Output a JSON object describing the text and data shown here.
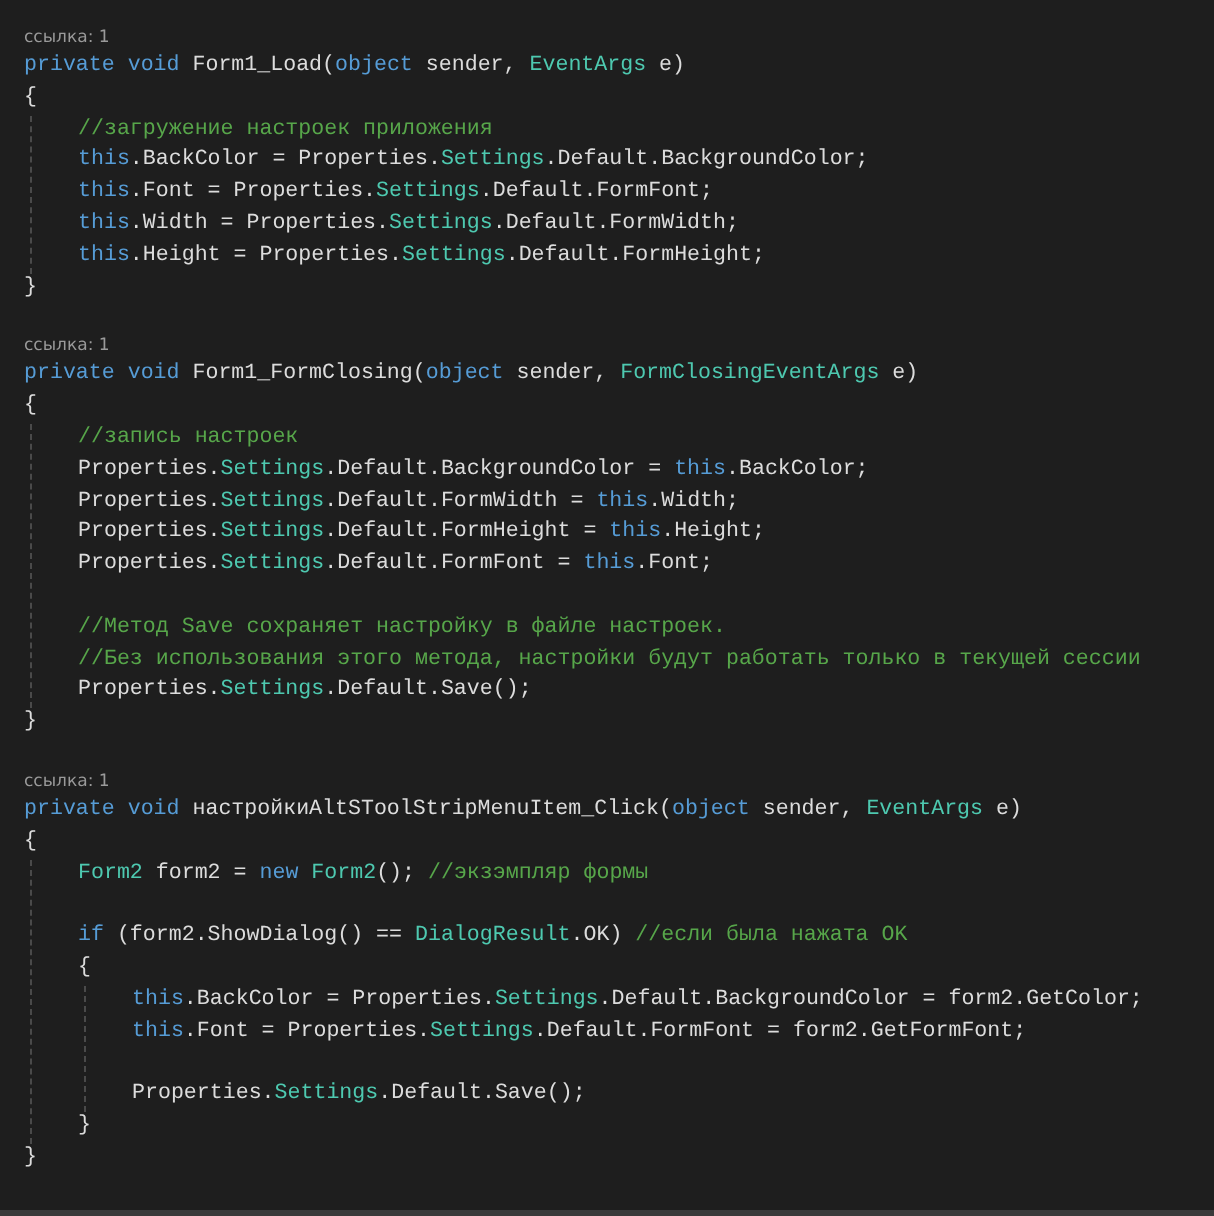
{
  "methods": [
    {
      "reference": "ссылка: 1",
      "signature": [
        {
          "kind": "keyword",
          "text": "private void"
        },
        {
          "kind": "plain",
          "text": " Form1_Load("
        },
        {
          "kind": "keyword",
          "text": "object"
        },
        {
          "kind": "plain",
          "text": " sender, "
        },
        {
          "kind": "type",
          "text": "EventArgs"
        },
        {
          "kind": "plain",
          "text": " e)"
        }
      ],
      "body": {
        "kind": "block",
        "open": "{",
        "close": "}",
        "children": [
          {
            "kind": "line",
            "tokens": [
              {
                "kind": "comment",
                "text": "//загружение настроек приложения"
              }
            ]
          },
          {
            "kind": "line",
            "tokens": [
              {
                "kind": "keyword",
                "text": "this"
              },
              {
                "kind": "plain",
                "text": ".BackColor = Properties."
              },
              {
                "kind": "type",
                "text": "Settings"
              },
              {
                "kind": "plain",
                "text": ".Default.BackgroundColor;"
              }
            ]
          },
          {
            "kind": "line",
            "tokens": [
              {
                "kind": "keyword",
                "text": "this"
              },
              {
                "kind": "plain",
                "text": ".Font = Properties."
              },
              {
                "kind": "type",
                "text": "Settings"
              },
              {
                "kind": "plain",
                "text": ".Default.FormFont;"
              }
            ]
          },
          {
            "kind": "line",
            "tokens": [
              {
                "kind": "keyword",
                "text": "this"
              },
              {
                "kind": "plain",
                "text": ".Width = Properties."
              },
              {
                "kind": "type",
                "text": "Settings"
              },
              {
                "kind": "plain",
                "text": ".Default.FormWidth;"
              }
            ]
          },
          {
            "kind": "line",
            "tokens": [
              {
                "kind": "keyword",
                "text": "this"
              },
              {
                "kind": "plain",
                "text": ".Height = Properties."
              },
              {
                "kind": "type",
                "text": "Settings"
              },
              {
                "kind": "plain",
                "text": ".Default.FormHeight;"
              }
            ]
          }
        ]
      }
    },
    {
      "reference": "ссылка: 1",
      "signature": [
        {
          "kind": "keyword",
          "text": "private void"
        },
        {
          "kind": "plain",
          "text": " Form1_FormClosing("
        },
        {
          "kind": "keyword",
          "text": "object"
        },
        {
          "kind": "plain",
          "text": " sender, "
        },
        {
          "kind": "type",
          "text": "FormClosingEventArgs"
        },
        {
          "kind": "plain",
          "text": " e)"
        }
      ],
      "body": {
        "kind": "block",
        "open": "{",
        "close": "}",
        "children": [
          {
            "kind": "line",
            "tokens": [
              {
                "kind": "comment",
                "text": "//запись настроек"
              }
            ]
          },
          {
            "kind": "line",
            "tokens": [
              {
                "kind": "plain",
                "text": "Properties."
              },
              {
                "kind": "type",
                "text": "Settings"
              },
              {
                "kind": "plain",
                "text": ".Default.BackgroundColor = "
              },
              {
                "kind": "keyword",
                "text": "this"
              },
              {
                "kind": "plain",
                "text": ".BackColor;"
              }
            ]
          },
          {
            "kind": "line",
            "tokens": [
              {
                "kind": "plain",
                "text": "Properties."
              },
              {
                "kind": "type",
                "text": "Settings"
              },
              {
                "kind": "plain",
                "text": ".Default.FormWidth = "
              },
              {
                "kind": "keyword",
                "text": "this"
              },
              {
                "kind": "plain",
                "text": ".Width;"
              }
            ]
          },
          {
            "kind": "line",
            "tokens": [
              {
                "kind": "plain",
                "text": "Properties."
              },
              {
                "kind": "type",
                "text": "Settings"
              },
              {
                "kind": "plain",
                "text": ".Default.FormHeight = "
              },
              {
                "kind": "keyword",
                "text": "this"
              },
              {
                "kind": "plain",
                "text": ".Height;"
              }
            ]
          },
          {
            "kind": "line",
            "tokens": [
              {
                "kind": "plain",
                "text": "Properties."
              },
              {
                "kind": "type",
                "text": "Settings"
              },
              {
                "kind": "plain",
                "text": ".Default.FormFont = "
              },
              {
                "kind": "keyword",
                "text": "this"
              },
              {
                "kind": "plain",
                "text": ".Font;"
              }
            ]
          },
          {
            "kind": "blank"
          },
          {
            "kind": "line",
            "tokens": [
              {
                "kind": "comment",
                "text": "//Метод Save сохраняет настройку в файле настроек."
              }
            ]
          },
          {
            "kind": "line",
            "tokens": [
              {
                "kind": "comment",
                "text": "//Без использования этого метода, настройки будут работать только в текущей сессии"
              }
            ]
          },
          {
            "kind": "line",
            "tokens": [
              {
                "kind": "plain",
                "text": "Properties."
              },
              {
                "kind": "type",
                "text": "Settings"
              },
              {
                "kind": "plain",
                "text": ".Default.Save();"
              }
            ]
          }
        ]
      }
    },
    {
      "reference": "ссылка: 1",
      "signature": [
        {
          "kind": "keyword",
          "text": "private void"
        },
        {
          "kind": "plain",
          "text": " настройкиAltSToolStripMenuItem_Click("
        },
        {
          "kind": "keyword",
          "text": "object"
        },
        {
          "kind": "plain",
          "text": " sender, "
        },
        {
          "kind": "type",
          "text": "EventArgs"
        },
        {
          "kind": "plain",
          "text": " e)"
        }
      ],
      "body": {
        "kind": "block",
        "open": "{",
        "close": "}",
        "children": [
          {
            "kind": "line",
            "tokens": [
              {
                "kind": "type",
                "text": "Form2"
              },
              {
                "kind": "plain",
                "text": " form2 = "
              },
              {
                "kind": "keyword",
                "text": "new "
              },
              {
                "kind": "type",
                "text": "Form2"
              },
              {
                "kind": "plain",
                "text": "(); "
              },
              {
                "kind": "comment",
                "text": "//экзэмпляр формы"
              }
            ]
          },
          {
            "kind": "blank"
          },
          {
            "kind": "line",
            "tokens": [
              {
                "kind": "keyword",
                "text": "if"
              },
              {
                "kind": "plain",
                "text": " (form2.ShowDialog() == "
              },
              {
                "kind": "type",
                "text": "DialogResult"
              },
              {
                "kind": "plain",
                "text": ".OK) "
              },
              {
                "kind": "comment",
                "text": "//если была нажата OK"
              }
            ]
          },
          {
            "kind": "block",
            "open": "{",
            "close": "}",
            "children": [
              {
                "kind": "line",
                "tokens": [
                  {
                    "kind": "keyword",
                    "text": "this"
                  },
                  {
                    "kind": "plain",
                    "text": ".BackColor = Properties."
                  },
                  {
                    "kind": "type",
                    "text": "Settings"
                  },
                  {
                    "kind": "plain",
                    "text": ".Default.BackgroundColor = form2.GetColor;"
                  }
                ]
              },
              {
                "kind": "line",
                "tokens": [
                  {
                    "kind": "keyword",
                    "text": "this"
                  },
                  {
                    "kind": "plain",
                    "text": ".Font = Properties."
                  },
                  {
                    "kind": "type",
                    "text": "Settings"
                  },
                  {
                    "kind": "plain",
                    "text": ".Default.FormFont = form2.GetFormFont;"
                  }
                ]
              },
              {
                "kind": "blank"
              },
              {
                "kind": "line",
                "tokens": [
                  {
                    "kind": "plain",
                    "text": "Properties."
                  },
                  {
                    "kind": "type",
                    "text": "Settings"
                  },
                  {
                    "kind": "plain",
                    "text": ".Default.Save();"
                  }
                ]
              }
            ]
          }
        ]
      }
    }
  ]
}
